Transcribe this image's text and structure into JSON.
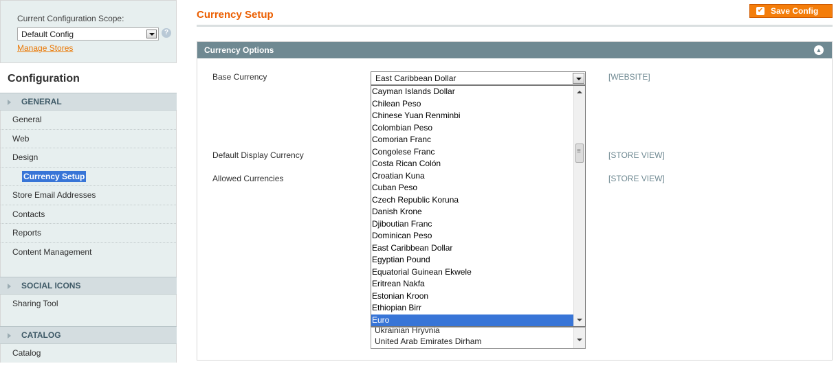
{
  "sidebar": {
    "scope_label": "Current Configuration Scope:",
    "scope_value": "Default Config",
    "manage_stores": "Manage Stores",
    "config_title": "Configuration",
    "groups": [
      {
        "title": "GENERAL",
        "items": [
          "General",
          "Web",
          "Design",
          "Currency Setup",
          "Store Email Addresses",
          "Contacts",
          "Reports",
          "Content Management"
        ]
      },
      {
        "title": "SOCIAL ICONS",
        "items": [
          "Sharing Tool"
        ]
      },
      {
        "title": "CATALOG",
        "items": [
          "Catalog"
        ]
      }
    ],
    "active_item": "Currency Setup"
  },
  "main": {
    "page_title": "Currency Setup",
    "save_button": "Save Config",
    "section_title": "Currency Options",
    "fields": {
      "base_currency_label": "Base Currency",
      "base_currency_value": "East Caribbean Dollar",
      "base_currency_scope": "[WEBSITE]",
      "display_currency_label": "Default Display Currency",
      "display_currency_scope": "[STORE VIEW]",
      "allowed_currencies_label": "Allowed Currencies",
      "allowed_currencies_scope": "[STORE VIEW]"
    },
    "dropdown_options": [
      "Cayman Islands Dollar",
      "Chilean Peso",
      "Chinese Yuan Renminbi",
      "Colombian Peso",
      "Comorian Franc",
      "Congolese Franc",
      "Costa Rican Colón",
      "Croatian Kuna",
      "Cuban Peso",
      "Czech Republic Koruna",
      "Danish Krone",
      "Djiboutian Franc",
      "Dominican Peso",
      "East Caribbean Dollar",
      "Egyptian Pound",
      "Equatorial Guinean Ekwele",
      "Eritrean Nakfa",
      "Estonian Kroon",
      "Ethiopian Birr",
      "Euro"
    ],
    "dropdown_selected": "Euro",
    "allowed_visible": [
      "Ukrainian Hryvnia",
      "United Arab Emirates Dirham"
    ]
  },
  "colors": {
    "accent_orange": "#f47d0a",
    "section_header": "#6f8992",
    "selection_blue": "#3875d7"
  }
}
